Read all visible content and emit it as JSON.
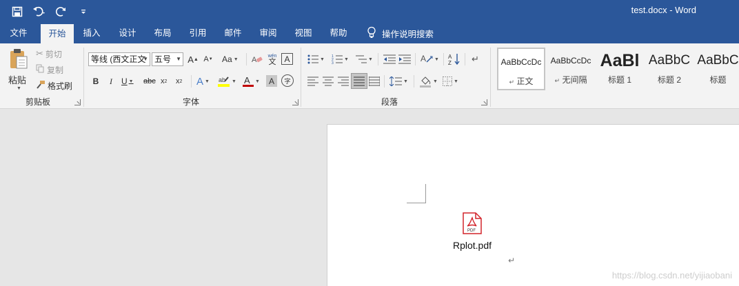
{
  "title_bar": {
    "doc_title": "test.docx  -  Word"
  },
  "tabs": [
    "文件",
    "开始",
    "插入",
    "设计",
    "布局",
    "引用",
    "邮件",
    "审阅",
    "视图",
    "帮助"
  ],
  "active_tab": "开始",
  "tell_me": "操作说明搜索",
  "clipboard": {
    "paste": "粘贴",
    "cut": "剪切",
    "copy": "复制",
    "format_painter": "格式刷",
    "label": "剪贴板"
  },
  "font": {
    "name": "等线 (西文正文",
    "size": "五号",
    "label": "字体",
    "aa_label": "Aa",
    "phonetic": "wén"
  },
  "paragraph": {
    "label": "段落"
  },
  "styles": [
    {
      "sample": "AaBbCcDc",
      "name": "正文",
      "mark": "↵"
    },
    {
      "sample": "AaBbCcDc",
      "name": "无间隔",
      "mark": "↵"
    },
    {
      "sample": "AaBl",
      "name": "标题 1",
      "mark": ""
    },
    {
      "sample": "AaBbC",
      "name": "标题 2",
      "mark": ""
    },
    {
      "sample": "AaBbC",
      "name": "标题",
      "mark": ""
    }
  ],
  "document": {
    "embedded_file": "Rplot.pdf",
    "pdf_badge": "PDF"
  },
  "watermark": "https://blog.csdn.net/yijiaobani",
  "colors": {
    "title_bar": "#2b579a",
    "ribbon": "#f3f3f3",
    "font_color": "#c00000",
    "highlight": "#ffff00",
    "pdf_red": "#d2232a"
  }
}
